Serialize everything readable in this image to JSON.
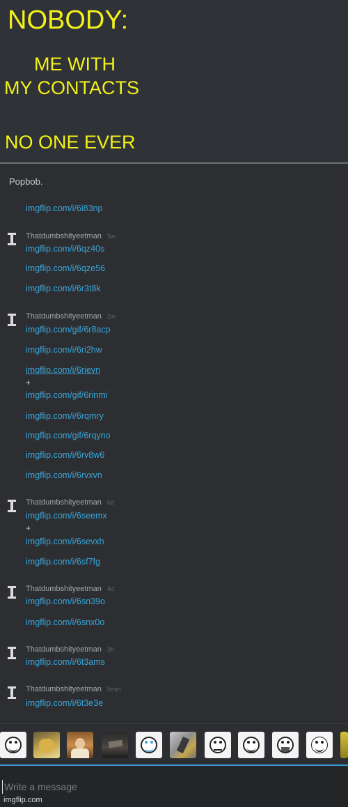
{
  "meme": {
    "nobody": "NOBODY:",
    "line1": "ME WITH",
    "line2": "MY CONTACTS",
    "line3": "NO ONE EVER",
    "text_color": "#f3f01a"
  },
  "chat": {
    "partner_name": "Popbob.",
    "link_color": "#3aa6da",
    "plus": "+",
    "groups": [
      {
        "sender": "",
        "time": "",
        "messages": [
          "imgflip.com/i/6i83np"
        ]
      },
      {
        "sender": "Thatdumbshityeetman",
        "time": "3w",
        "messages": [
          "imgflip.com/i/6qz40s",
          "imgflip.com/i/6qze56",
          "imgflip.com/i/6r3t8k"
        ]
      },
      {
        "sender": "Thatdumbshityeetman",
        "time": "2w",
        "messages": [
          "imgflip.com/gif/6r8acp",
          "imgflip.com/i/6ri2hw",
          "imgflip.com/i/6rievn",
          "imgflip.com/gif/6rinmi",
          "imgflip.com/i/6rqmry",
          "imgflip.com/gif/6rqyno",
          "imgflip.com/i/6rv8w6",
          "imgflip.com/i/6rvxvn"
        ]
      },
      {
        "sender": "Thatdumbshityeetman",
        "time": "6d",
        "messages": [
          "imgflip.com/i/6seemx",
          "imgflip.com/i/6sevxh",
          "imgflip.com/i/6sf7fg"
        ]
      },
      {
        "sender": "Thatdumbshityeetman",
        "time": "4d",
        "messages": [
          "imgflip.com/i/6sn39o",
          "imgflip.com/i/6snx0o"
        ]
      },
      {
        "sender": "Thatdumbshityeetman",
        "time": "3h",
        "messages": [
          "imgflip.com/i/6t3ams"
        ]
      },
      {
        "sender": "Thatdumbshityeetman",
        "time": "5min",
        "messages": [
          "imgflip.com/i/6t3e3e"
        ]
      }
    ]
  },
  "stickers": [
    {
      "icon": "rage-derp-face-icon"
    },
    {
      "icon": "cat-photo-icon"
    },
    {
      "icon": "jesus-photo-icon"
    },
    {
      "icon": "dark-photo-icon"
    },
    {
      "icon": "crying-face-icon"
    },
    {
      "icon": "doge-photo-icon"
    },
    {
      "icon": "rage-face-icon"
    },
    {
      "icon": "okay-face-icon"
    },
    {
      "icon": "laughing-face-icon"
    },
    {
      "icon": "forever-alone-face-icon"
    },
    {
      "icon": "yellow-partial-icon"
    }
  ],
  "composer": {
    "placeholder": "Write a message",
    "accent_color": "#3a9ad3"
  },
  "watermark": "imgflip.com"
}
